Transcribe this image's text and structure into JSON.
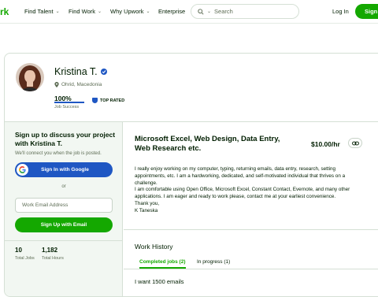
{
  "nav": {
    "logo": "rk",
    "find_talent": "Find Talent",
    "find_work": "Find Work",
    "why_upwork": "Why Upwork",
    "enterprise": "Enterprise",
    "search_placeholder": "Search",
    "login": "Log In",
    "signup": "Sign"
  },
  "profile": {
    "name": "Kristina T.",
    "location": "Ohrid, Macedonia",
    "job_success_value": "100%",
    "job_success_fraction": 1.0,
    "job_success_label": "Job Success",
    "badge": "TOP RATED"
  },
  "signup_panel": {
    "title": "Sign up to discuss your project with Kristina T.",
    "note": "We'll connect you when the job is posted.",
    "google_button": "Sign In with Google",
    "or": "or",
    "email_placeholder": "Work Email Address",
    "email_button": "Sign Up with Email"
  },
  "stats": {
    "total_jobs_value": "10",
    "total_jobs_label": "Total Jobs",
    "total_hours_value": "1,182",
    "total_hours_label": "Total Hours"
  },
  "main": {
    "title": "Microsoft Excel, Web Design, Data Entry, Web Research etc.",
    "rate": "$10.00/hr",
    "description": [
      "I really enjoy working on my computer, typing, returning emails, data entry, research, setting appointments, etc. I am a hardworking, dedicated, and self-motivated individual that thrives on a challenge.",
      "I am comfortable using Open Office, Microsoft Excel, Constant Contact, Evernote, and many other applications. I am eager and ready to work please, contact me at your earliest convenience.",
      "Thank you,",
      "K Taneska"
    ],
    "work_history_title": "Work History",
    "tab_completed": "Completed jobs (2)",
    "tab_in_progress": "In progress (1)",
    "first_job_title": "I want 1500 emails"
  },
  "colors": {
    "brand_green": "#14a800",
    "google_blue": "#1f57c3",
    "text_dark": "#001e00",
    "text_muted": "#5e6d55",
    "panel_bg": "#f2f7f2"
  },
  "icons": {
    "search": "search-icon",
    "location": "location-pin-icon",
    "verified": "verified-badge-icon",
    "top_rated": "top-rated-shield-icon",
    "link": "link-icon",
    "google": "google-icon"
  }
}
